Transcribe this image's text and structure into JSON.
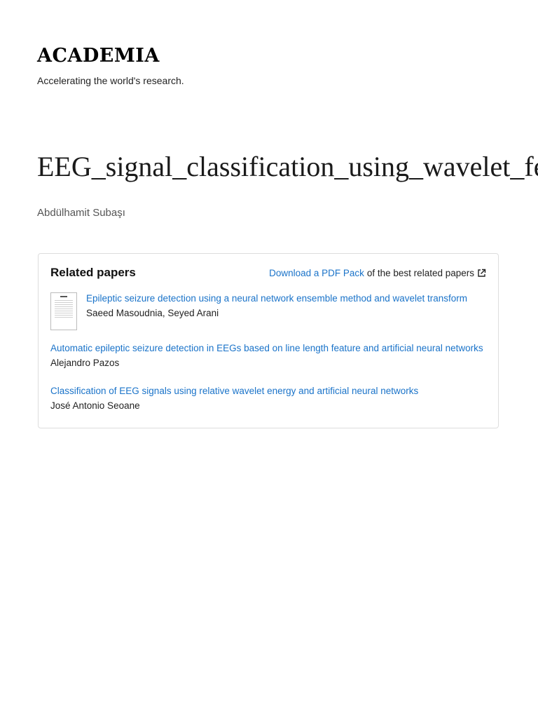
{
  "header": {
    "brand": "ACADEMIA",
    "tagline": "Accelerating the world's research."
  },
  "paper": {
    "title": "EEG_signal_classification_using_wavelet_feature_extraction_and_a_mixture_of_expert_model",
    "author": "Abdülhamit Subaşı"
  },
  "related": {
    "heading": "Related papers",
    "download_link": "Download a PDF Pack",
    "download_suffix": "of the best related papers",
    "items": [
      {
        "title": "Epileptic seizure detection using a neural network ensemble method and wavelet transform",
        "authors": "Saeed Masoudnia, Seyed Arani"
      },
      {
        "title": "Automatic epileptic seizure detection in EEGs based on line length feature and artificial neural networks",
        "authors": "Alejandro Pazos"
      },
      {
        "title": "Classification of EEG signals using relative wavelet energy and artificial neural networks",
        "authors": "José Antonio Seoane"
      }
    ]
  },
  "colors": {
    "link": "#1a73c9",
    "text": "#1a1a1a",
    "border": "#dddddd"
  },
  "icons": {
    "external": "external-link-icon",
    "thumbnail": "paper-thumbnail"
  }
}
